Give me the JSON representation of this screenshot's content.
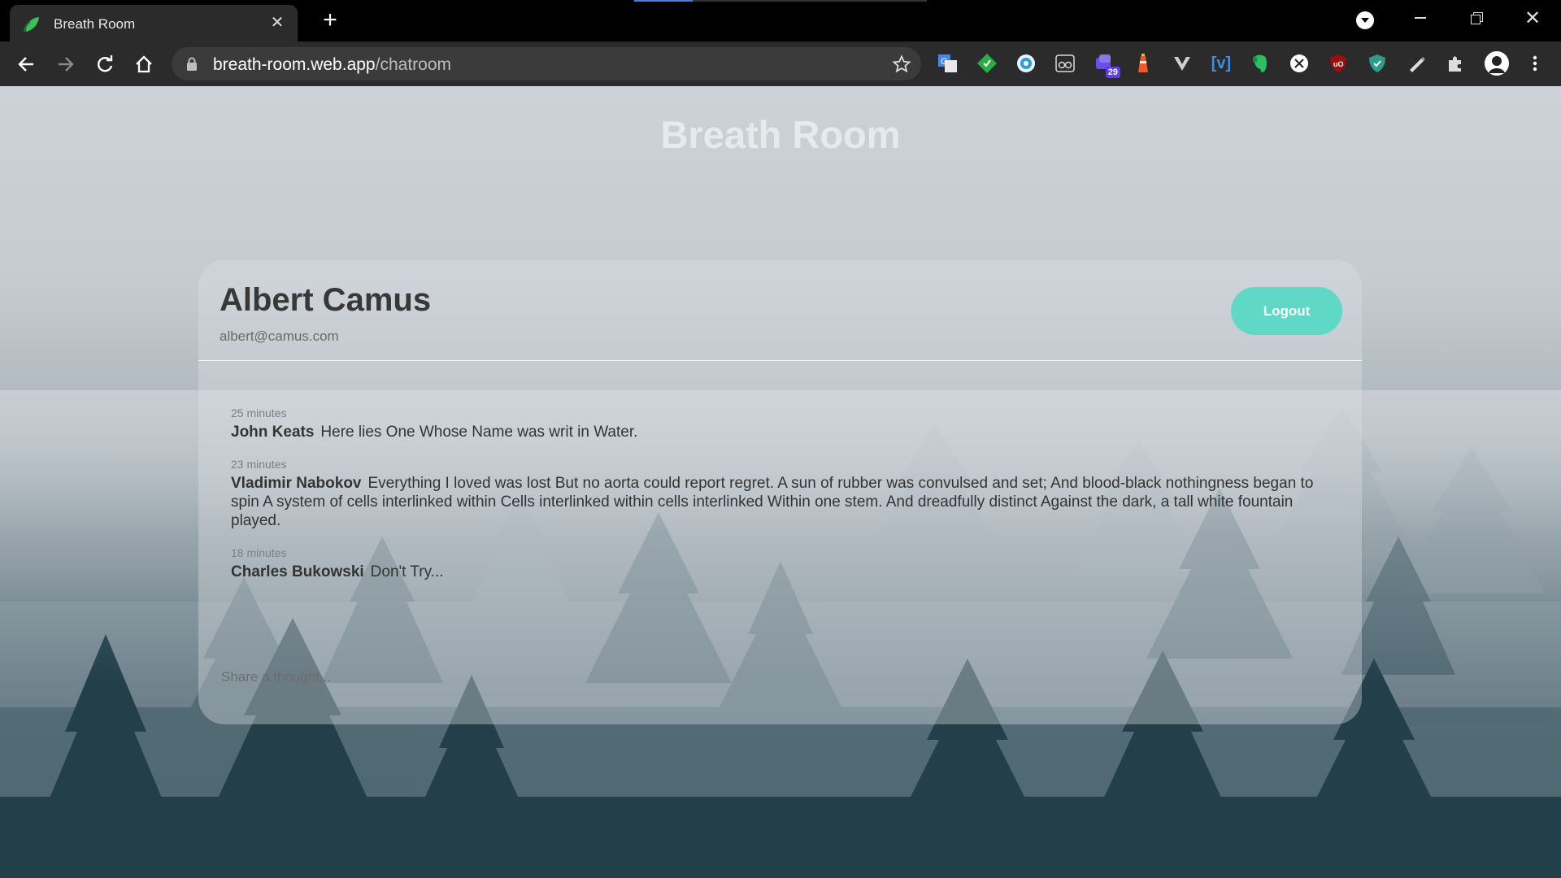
{
  "browser": {
    "tab_title": "Breath Room",
    "tab_close": "✕",
    "new_tab": "+",
    "url_host": "breath-room.web.app",
    "url_path": "/chatroom",
    "extensions": [
      {
        "name": "google-translate-icon"
      },
      {
        "name": "green-diamond-extension-icon"
      },
      {
        "name": "globe-extension-icon"
      },
      {
        "name": "reader-glasses-icon"
      },
      {
        "name": "tabs-counter-icon",
        "badge": "29"
      },
      {
        "name": "lighthouse-icon"
      },
      {
        "name": "vivaldi-v-icon"
      },
      {
        "name": "vue-devtools-icon",
        "text": "[v]"
      },
      {
        "name": "evernote-icon"
      },
      {
        "name": "x-circle-extension-icon"
      },
      {
        "name": "ublock-origin-icon",
        "text": "uO"
      },
      {
        "name": "shield-extension-icon"
      },
      {
        "name": "pen-extension-icon"
      },
      {
        "name": "puzzle-extensions-icon"
      },
      {
        "name": "profile-avatar-icon"
      },
      {
        "name": "kebab-menu-icon"
      }
    ],
    "colors": {
      "tab_strip": "#000000",
      "toolbar": "#2b2b2b",
      "omnibox": "#3b3b3b"
    }
  },
  "app": {
    "title": "Breath Room",
    "accent": "#5fd8c8"
  },
  "user": {
    "name": "Albert Camus",
    "email": "albert@camus.com",
    "logout_label": "Logout"
  },
  "messages": [
    {
      "time": "25 minutes",
      "author": "John Keats",
      "text": "Here lies One Whose Name was writ in Water."
    },
    {
      "time": "23 minutes",
      "author": "Vladimir Nabokov",
      "text": "Everything I loved was lost But no aorta could report regret. A sun of rubber was convulsed and set; And blood-black nothingness began to spin A system of cells interlinked within Cells interlinked within cells interlinked Within one stem. And dreadfully distinct Against the dark, a tall white fountain played."
    },
    {
      "time": "18 minutes",
      "author": "Charles Bukowski",
      "text": "Don't Try..."
    }
  ],
  "composer": {
    "placeholder": "Share a thought..."
  }
}
